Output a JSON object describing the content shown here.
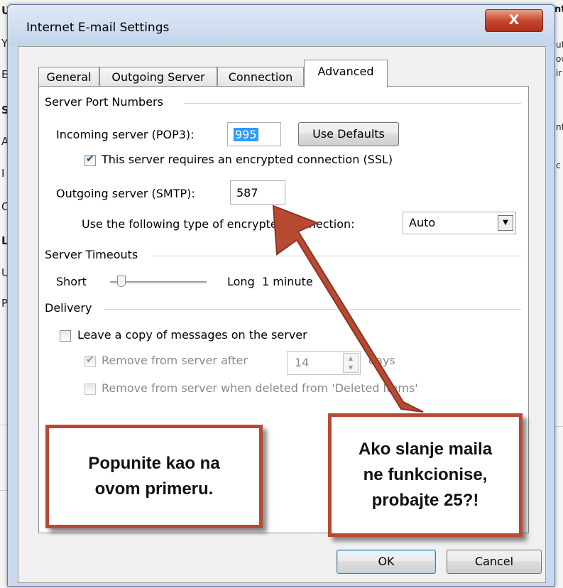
{
  "dialog": {
    "title": "Internet E-mail Settings",
    "close_label": "X"
  },
  "tabs": [
    {
      "label": "General",
      "active": false
    },
    {
      "label": "Outgoing Server",
      "active": false
    },
    {
      "label": "Connection",
      "active": false
    },
    {
      "label": "Advanced",
      "active": true
    }
  ],
  "port_numbers": {
    "group_label": "Server Port Numbers",
    "incoming_label": "Incoming server (POP3):",
    "incoming_value": "995",
    "use_defaults_label": "Use Defaults",
    "ssl_label": "This server requires an encrypted connection (SSL)",
    "ssl_checked": true,
    "outgoing_label": "Outgoing server (SMTP):",
    "outgoing_value": "587",
    "encryption_label": "Use the following type of encrypted connection:",
    "encryption_value": "Auto"
  },
  "timeouts": {
    "group_label": "Server Timeouts",
    "short_label": "Short",
    "long_label": "Long",
    "value_label": "1 minute",
    "level": 0.08
  },
  "delivery": {
    "group_label": "Delivery",
    "leave_copy_label": "Leave a copy of messages on the server",
    "leave_copy_checked": false,
    "remove_after_label": "Remove from server after",
    "remove_after_checked": true,
    "days_value": "14",
    "days_label": "days",
    "remove_deleted_label": "Remove from server when deleted from 'Deleted Items'",
    "remove_deleted_checked": false
  },
  "buttons": {
    "ok_label": "OK",
    "cancel_label": "Cancel"
  },
  "annotations": {
    "left_note": "Popunite kao na\novom primeru.",
    "right_note": "Ako slanje maila\nne funkcionise,\nprobajte 25?!",
    "border_color": "#b84a33",
    "arrow_color": "#b84a33"
  },
  "background_window": {
    "left_letters": [
      "U",
      "Y",
      "E",
      "S",
      "A",
      "I",
      "C",
      "L",
      "U",
      "P"
    ],
    "right_letters": [
      "nt",
      "ut",
      "ou",
      "ir",
      "nt",
      "c"
    ]
  }
}
